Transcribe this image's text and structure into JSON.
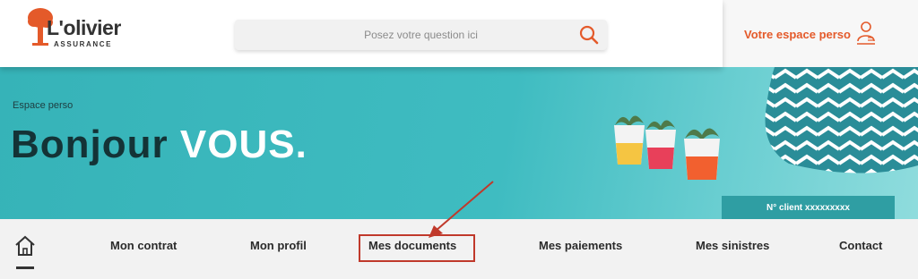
{
  "header": {
    "logo": {
      "name": "L'olivier",
      "subtitle": "ASSURANCE",
      "icon": "olive-tree-logo"
    },
    "search": {
      "placeholder": "Posez votre question ici",
      "icon": "search-icon"
    },
    "account_button": {
      "label": "Votre espace perso",
      "icon": "user-icon"
    }
  },
  "hero": {
    "tag": "Espace perso",
    "greeting": "Bonjour",
    "name": "VOUS.",
    "client_number": "N° client xxxxxxxxx"
  },
  "nav": {
    "home_icon": "home-icon",
    "items": [
      {
        "label": "Mon contrat"
      },
      {
        "label": "Mon profil"
      },
      {
        "label": "Mes documents"
      },
      {
        "label": "Mes paiements"
      },
      {
        "label": "Mes sinistres"
      },
      {
        "label": "Contact"
      }
    ],
    "highlighted_index": 2
  },
  "colors": {
    "brand_orange": "#e45a2a",
    "hero_teal": "#3fbcc1",
    "client_box": "#2f9ea3",
    "annotation_red": "#c0392b",
    "nav_background": "#f2f2f2"
  }
}
